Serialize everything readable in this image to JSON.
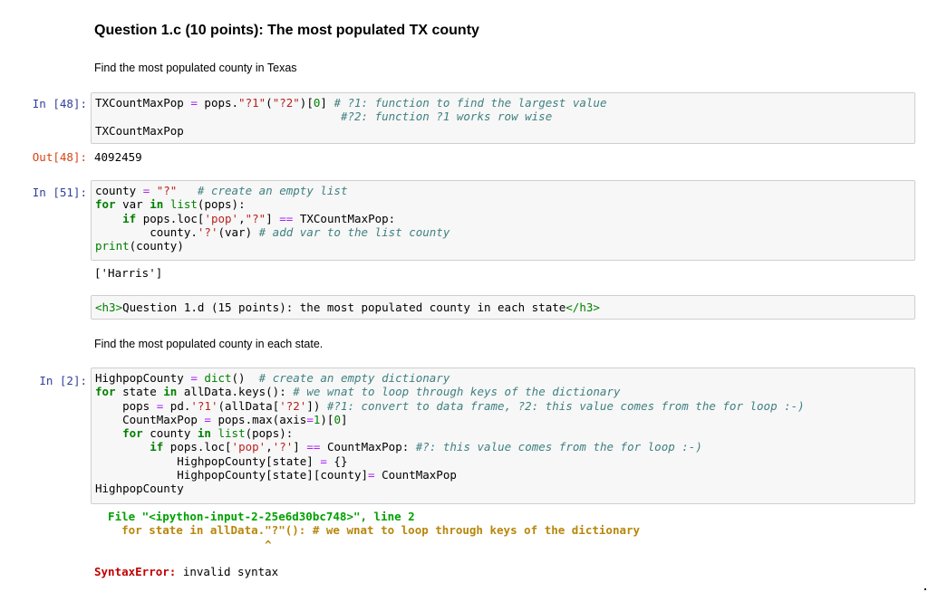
{
  "q1c": {
    "heading": "Question 1.c (10 points): The most populated TX county",
    "desc": "Find the most populated county in Texas"
  },
  "cell48": {
    "in_prompt": "In [48]:",
    "out_prompt": "Out[48]:",
    "output": "4092459",
    "code": [
      [
        [
          "t",
          "TXCountMaxPop "
        ],
        [
          "o",
          "="
        ],
        [
          "t",
          " pops."
        ],
        [
          "s",
          "\"?1\""
        ],
        [
          "t",
          "("
        ],
        [
          "s",
          "\"?2\""
        ],
        [
          "t",
          ")["
        ],
        [
          "n",
          "0"
        ],
        [
          "t",
          "] "
        ],
        [
          "c",
          "# ?1: function to find the largest value"
        ]
      ],
      [
        [
          "t",
          "                                    "
        ],
        [
          "c",
          "#?2: function ?1 works row wise"
        ]
      ],
      [
        [
          "t",
          "TXCountMaxPop"
        ]
      ]
    ]
  },
  "cell51": {
    "in_prompt": "In [51]:",
    "output": "['Harris']",
    "code": [
      [
        [
          "t",
          "county "
        ],
        [
          "o",
          "="
        ],
        [
          "t",
          " "
        ],
        [
          "s",
          "\"?\""
        ],
        [
          "t",
          "   "
        ],
        [
          "c",
          "# create an empty list"
        ]
      ],
      [
        [
          "k",
          "for"
        ],
        [
          "t",
          " var "
        ],
        [
          "k",
          "in"
        ],
        [
          "t",
          " "
        ],
        [
          "b",
          "list"
        ],
        [
          "t",
          "(pops):"
        ]
      ],
      [
        [
          "t",
          "    "
        ],
        [
          "k",
          "if"
        ],
        [
          "t",
          " pops.loc["
        ],
        [
          "s",
          "'pop'"
        ],
        [
          "t",
          ","
        ],
        [
          "s",
          "\"?\""
        ],
        [
          "t",
          "] "
        ],
        [
          "o",
          "=="
        ],
        [
          "t",
          " TXCountMaxPop:"
        ]
      ],
      [
        [
          "t",
          "        county."
        ],
        [
          "s",
          "'?'"
        ],
        [
          "t",
          "(var) "
        ],
        [
          "c",
          "# add var to the list county"
        ]
      ],
      [
        [
          "b",
          "print"
        ],
        [
          "t",
          "(county)"
        ]
      ]
    ]
  },
  "raw_cell": {
    "parts": [
      [
        "tg",
        "<h3>"
      ],
      [
        "t",
        "Question 1.d (15 points): the most populated county in each state"
      ],
      [
        "tg",
        "</h3>"
      ]
    ]
  },
  "q1d": {
    "desc": "Find the most populated county in each state."
  },
  "cell2": {
    "in_prompt": "In [2]:",
    "code": [
      [
        [
          "t",
          "HighpopCounty "
        ],
        [
          "o",
          "="
        ],
        [
          "t",
          " "
        ],
        [
          "b",
          "dict"
        ],
        [
          "t",
          "()  "
        ],
        [
          "c",
          "# create an empty dictionary"
        ]
      ],
      [
        [
          "k",
          "for"
        ],
        [
          "t",
          " state "
        ],
        [
          "k",
          "in"
        ],
        [
          "t",
          " allData.keys(): "
        ],
        [
          "c",
          "# we wnat to loop through keys of the dictionary"
        ]
      ],
      [
        [
          "t",
          "    pops "
        ],
        [
          "o",
          "="
        ],
        [
          "t",
          " pd."
        ],
        [
          "s",
          "'?1'"
        ],
        [
          "t",
          "(allData["
        ],
        [
          "s",
          "'?2'"
        ],
        [
          "t",
          "]) "
        ],
        [
          "c",
          "#?1: convert to data frame, ?2: this value comes from the for loop :-)"
        ]
      ],
      [
        [
          "t",
          "    CountMaxPop "
        ],
        [
          "o",
          "="
        ],
        [
          "t",
          " pops.max(axis"
        ],
        [
          "o",
          "="
        ],
        [
          "n",
          "1"
        ],
        [
          "t",
          ")["
        ],
        [
          "n",
          "0"
        ],
        [
          "t",
          "]"
        ]
      ],
      [
        [
          "t",
          "    "
        ],
        [
          "k",
          "for"
        ],
        [
          "t",
          " county "
        ],
        [
          "k",
          "in"
        ],
        [
          "t",
          " "
        ],
        [
          "b",
          "list"
        ],
        [
          "t",
          "(pops):"
        ]
      ],
      [
        [
          "t",
          "        "
        ],
        [
          "k",
          "if"
        ],
        [
          "t",
          " pops.loc["
        ],
        [
          "s",
          "'pop'"
        ],
        [
          "t",
          ","
        ],
        [
          "s",
          "'?'"
        ],
        [
          "t",
          "] "
        ],
        [
          "o",
          "=="
        ],
        [
          "t",
          " CountMaxPop: "
        ],
        [
          "c",
          "#?: this value comes from the for loop :-)"
        ]
      ],
      [
        [
          "t",
          "            HighpopCounty[state] "
        ],
        [
          "o",
          "="
        ],
        [
          "t",
          " {}"
        ]
      ],
      [
        [
          "t",
          "            HighpopCounty[state][county]"
        ],
        [
          "o",
          "="
        ],
        [
          "t",
          " CountMaxPop"
        ]
      ],
      [
        [
          "t",
          "HighpopCounty"
        ]
      ]
    ],
    "traceback": [
      [
        [
          "g",
          "  File \"<ipython-input-2-25e6d30bc748>\", line 2"
        ]
      ],
      [
        [
          "y",
          "    for state in allData.\"?\"(): # we wnat to loop through keys of the dictionary"
        ]
      ],
      [
        [
          "y",
          "                         ^"
        ]
      ],
      [
        [
          "t",
          " "
        ]
      ],
      [
        [
          "r",
          "SyntaxError:"
        ],
        [
          "t",
          " invalid syntax"
        ]
      ]
    ]
  }
}
